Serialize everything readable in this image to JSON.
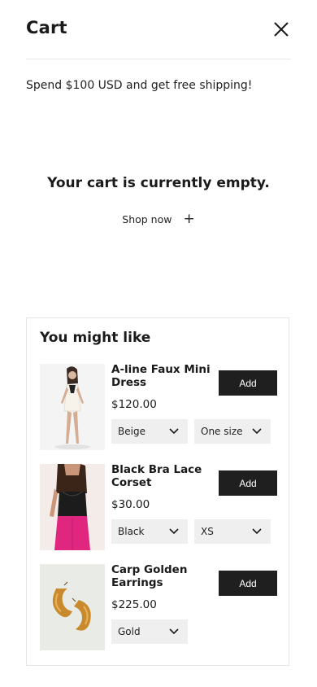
{
  "header": {
    "title": "Cart",
    "close_icon": "close-icon"
  },
  "shipping_message": "Spend $100 USD and get free shipping!",
  "empty": {
    "message": "Your cart is currently empty.",
    "shop_now_label": "Shop now",
    "shop_now_icon": "plus-icon"
  },
  "recommendations": {
    "title": "You might like",
    "products": [
      {
        "name": "A-line Faux Mini Dress",
        "price": "$120.00",
        "add_label": "Add",
        "color": "Beige",
        "size": "One size"
      },
      {
        "name": "Black Bra Lace Corset",
        "price": "$30.00",
        "add_label": "Add",
        "color": "Black",
        "size": "XS"
      },
      {
        "name": "Carp Golden Earrings",
        "price": "$225.00",
        "add_label": "Add",
        "color": "Gold"
      }
    ]
  },
  "colors": {
    "button_bg": "#1f1f1f",
    "select_bg": "#efefef",
    "border": "#e6e6e6"
  }
}
